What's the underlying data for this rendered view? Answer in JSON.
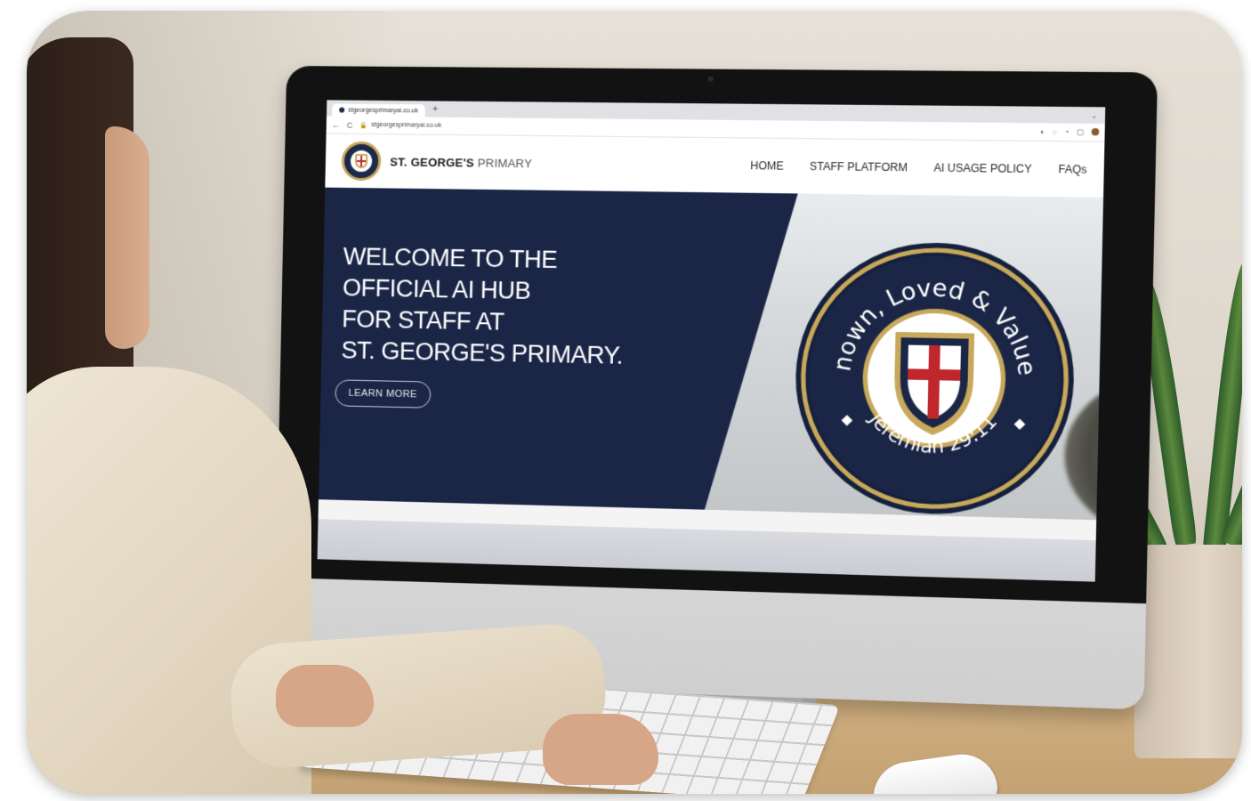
{
  "browser": {
    "tab_title": "stgeorgesprimaryai.co.uk",
    "new_tab": "+",
    "window_control": "⌄",
    "url": "stgeorgesprimaryai.co.uk",
    "back": "←",
    "reload": "C"
  },
  "site": {
    "brand_bold": "ST. GEORGE'S",
    "brand_light": "PRIMARY",
    "nav": [
      "HOME",
      "STAFF PLATFORM",
      "AI USAGE POLICY",
      "FAQs"
    ]
  },
  "hero": {
    "title_lines": [
      "WELCOME TO THE",
      "OFFICIAL AI HUB",
      "FOR STAFF AT",
      "ST. GEORGE'S PRIMARY."
    ],
    "cta_label": "LEARN MORE"
  },
  "badge": {
    "motto": "Known, Loved & Valued",
    "verse": "Jeremiah 29:11"
  },
  "colors": {
    "navy": "#1b2647",
    "gold": "#c8a85a",
    "cross_red": "#c0272d"
  },
  "icons": [
    "back-arrow-icon",
    "reload-icon",
    "lock-icon",
    "school-crest-icon",
    "shield-cross-icon"
  ]
}
